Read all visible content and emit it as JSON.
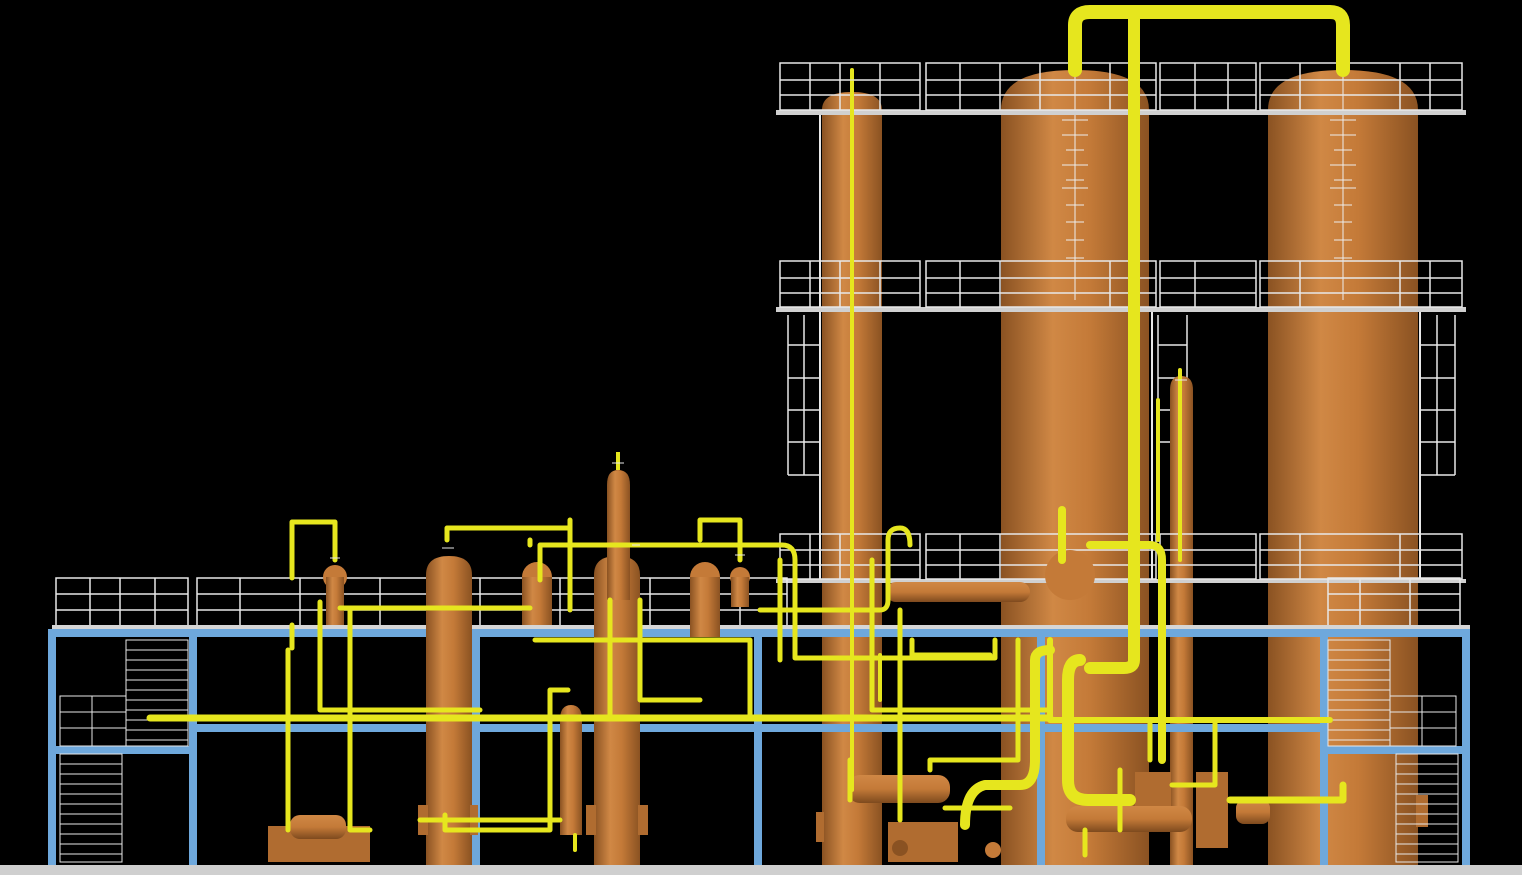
{
  "viewer": {
    "caption": ""
  },
  "colors": {
    "background": "#000000",
    "vessel": "#C47A38",
    "vessel_shade": "#8A5222",
    "pipe": "#E6E61E",
    "pipe_shade": "#A8A80C",
    "railing": "#E8E8E8",
    "deck": "#C8C8C8",
    "structure": "#6EA8DC"
  },
  "components": [
    {
      "name": "tall-column-1",
      "kind": "vertical-vessel"
    },
    {
      "name": "large-column-2",
      "kind": "vertical-vessel"
    },
    {
      "name": "large-column-3",
      "kind": "vertical-vessel"
    },
    {
      "name": "medium-vessel-a",
      "kind": "vertical-vessel"
    },
    {
      "name": "medium-vessel-b",
      "kind": "vertical-vessel"
    },
    {
      "name": "slim-vessel-c",
      "kind": "vertical-vessel"
    },
    {
      "name": "small-vessel-d",
      "kind": "vertical-vessel"
    },
    {
      "name": "horizontal-drum-1",
      "kind": "horizontal-vessel"
    },
    {
      "name": "horizontal-drum-2",
      "kind": "horizontal-vessel"
    },
    {
      "name": "pump-skid-1",
      "kind": "pump"
    },
    {
      "name": "pump-skid-2",
      "kind": "pump"
    },
    {
      "name": "pump-skid-3",
      "kind": "pump"
    },
    {
      "name": "steel-frame",
      "kind": "structure"
    },
    {
      "name": "platforms",
      "kind": "walkway"
    },
    {
      "name": "stairs",
      "kind": "access"
    },
    {
      "name": "pipe-network",
      "kind": "piping"
    }
  ]
}
